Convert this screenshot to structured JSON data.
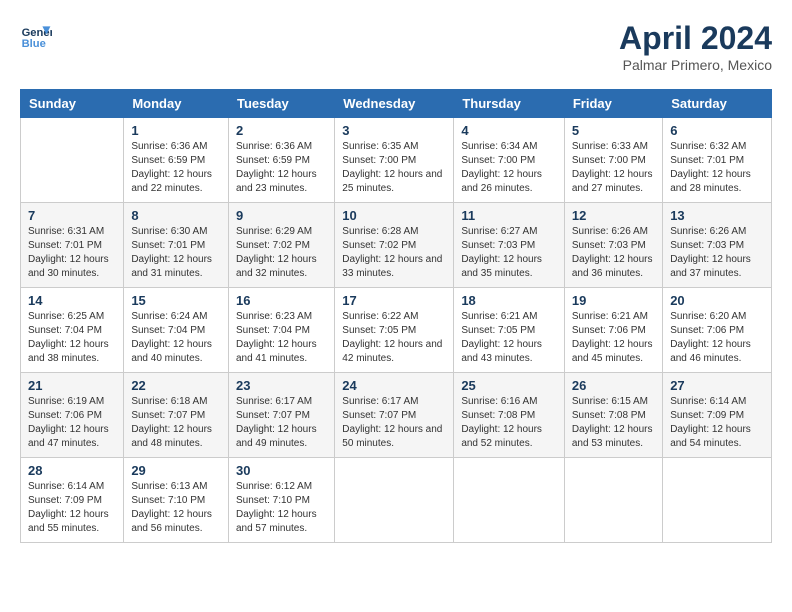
{
  "header": {
    "logo_line1": "General",
    "logo_line2": "Blue",
    "title": "April 2024",
    "location": "Palmar Primero, Mexico"
  },
  "weekdays": [
    "Sunday",
    "Monday",
    "Tuesday",
    "Wednesday",
    "Thursday",
    "Friday",
    "Saturday"
  ],
  "weeks": [
    [
      {
        "day": "",
        "sunrise": "",
        "sunset": "",
        "daylight": ""
      },
      {
        "day": "1",
        "sunrise": "Sunrise: 6:36 AM",
        "sunset": "Sunset: 6:59 PM",
        "daylight": "Daylight: 12 hours and 22 minutes."
      },
      {
        "day": "2",
        "sunrise": "Sunrise: 6:36 AM",
        "sunset": "Sunset: 6:59 PM",
        "daylight": "Daylight: 12 hours and 23 minutes."
      },
      {
        "day": "3",
        "sunrise": "Sunrise: 6:35 AM",
        "sunset": "Sunset: 7:00 PM",
        "daylight": "Daylight: 12 hours and 25 minutes."
      },
      {
        "day": "4",
        "sunrise": "Sunrise: 6:34 AM",
        "sunset": "Sunset: 7:00 PM",
        "daylight": "Daylight: 12 hours and 26 minutes."
      },
      {
        "day": "5",
        "sunrise": "Sunrise: 6:33 AM",
        "sunset": "Sunset: 7:00 PM",
        "daylight": "Daylight: 12 hours and 27 minutes."
      },
      {
        "day": "6",
        "sunrise": "Sunrise: 6:32 AM",
        "sunset": "Sunset: 7:01 PM",
        "daylight": "Daylight: 12 hours and 28 minutes."
      }
    ],
    [
      {
        "day": "7",
        "sunrise": "Sunrise: 6:31 AM",
        "sunset": "Sunset: 7:01 PM",
        "daylight": "Daylight: 12 hours and 30 minutes."
      },
      {
        "day": "8",
        "sunrise": "Sunrise: 6:30 AM",
        "sunset": "Sunset: 7:01 PM",
        "daylight": "Daylight: 12 hours and 31 minutes."
      },
      {
        "day": "9",
        "sunrise": "Sunrise: 6:29 AM",
        "sunset": "Sunset: 7:02 PM",
        "daylight": "Daylight: 12 hours and 32 minutes."
      },
      {
        "day": "10",
        "sunrise": "Sunrise: 6:28 AM",
        "sunset": "Sunset: 7:02 PM",
        "daylight": "Daylight: 12 hours and 33 minutes."
      },
      {
        "day": "11",
        "sunrise": "Sunrise: 6:27 AM",
        "sunset": "Sunset: 7:03 PM",
        "daylight": "Daylight: 12 hours and 35 minutes."
      },
      {
        "day": "12",
        "sunrise": "Sunrise: 6:26 AM",
        "sunset": "Sunset: 7:03 PM",
        "daylight": "Daylight: 12 hours and 36 minutes."
      },
      {
        "day": "13",
        "sunrise": "Sunrise: 6:26 AM",
        "sunset": "Sunset: 7:03 PM",
        "daylight": "Daylight: 12 hours and 37 minutes."
      }
    ],
    [
      {
        "day": "14",
        "sunrise": "Sunrise: 6:25 AM",
        "sunset": "Sunset: 7:04 PM",
        "daylight": "Daylight: 12 hours and 38 minutes."
      },
      {
        "day": "15",
        "sunrise": "Sunrise: 6:24 AM",
        "sunset": "Sunset: 7:04 PM",
        "daylight": "Daylight: 12 hours and 40 minutes."
      },
      {
        "day": "16",
        "sunrise": "Sunrise: 6:23 AM",
        "sunset": "Sunset: 7:04 PM",
        "daylight": "Daylight: 12 hours and 41 minutes."
      },
      {
        "day": "17",
        "sunrise": "Sunrise: 6:22 AM",
        "sunset": "Sunset: 7:05 PM",
        "daylight": "Daylight: 12 hours and 42 minutes."
      },
      {
        "day": "18",
        "sunrise": "Sunrise: 6:21 AM",
        "sunset": "Sunset: 7:05 PM",
        "daylight": "Daylight: 12 hours and 43 minutes."
      },
      {
        "day": "19",
        "sunrise": "Sunrise: 6:21 AM",
        "sunset": "Sunset: 7:06 PM",
        "daylight": "Daylight: 12 hours and 45 minutes."
      },
      {
        "day": "20",
        "sunrise": "Sunrise: 6:20 AM",
        "sunset": "Sunset: 7:06 PM",
        "daylight": "Daylight: 12 hours and 46 minutes."
      }
    ],
    [
      {
        "day": "21",
        "sunrise": "Sunrise: 6:19 AM",
        "sunset": "Sunset: 7:06 PM",
        "daylight": "Daylight: 12 hours and 47 minutes."
      },
      {
        "day": "22",
        "sunrise": "Sunrise: 6:18 AM",
        "sunset": "Sunset: 7:07 PM",
        "daylight": "Daylight: 12 hours and 48 minutes."
      },
      {
        "day": "23",
        "sunrise": "Sunrise: 6:17 AM",
        "sunset": "Sunset: 7:07 PM",
        "daylight": "Daylight: 12 hours and 49 minutes."
      },
      {
        "day": "24",
        "sunrise": "Sunrise: 6:17 AM",
        "sunset": "Sunset: 7:07 PM",
        "daylight": "Daylight: 12 hours and 50 minutes."
      },
      {
        "day": "25",
        "sunrise": "Sunrise: 6:16 AM",
        "sunset": "Sunset: 7:08 PM",
        "daylight": "Daylight: 12 hours and 52 minutes."
      },
      {
        "day": "26",
        "sunrise": "Sunrise: 6:15 AM",
        "sunset": "Sunset: 7:08 PM",
        "daylight": "Daylight: 12 hours and 53 minutes."
      },
      {
        "day": "27",
        "sunrise": "Sunrise: 6:14 AM",
        "sunset": "Sunset: 7:09 PM",
        "daylight": "Daylight: 12 hours and 54 minutes."
      }
    ],
    [
      {
        "day": "28",
        "sunrise": "Sunrise: 6:14 AM",
        "sunset": "Sunset: 7:09 PM",
        "daylight": "Daylight: 12 hours and 55 minutes."
      },
      {
        "day": "29",
        "sunrise": "Sunrise: 6:13 AM",
        "sunset": "Sunset: 7:10 PM",
        "daylight": "Daylight: 12 hours and 56 minutes."
      },
      {
        "day": "30",
        "sunrise": "Sunrise: 6:12 AM",
        "sunset": "Sunset: 7:10 PM",
        "daylight": "Daylight: 12 hours and 57 minutes."
      },
      {
        "day": "",
        "sunrise": "",
        "sunset": "",
        "daylight": ""
      },
      {
        "day": "",
        "sunrise": "",
        "sunset": "",
        "daylight": ""
      },
      {
        "day": "",
        "sunrise": "",
        "sunset": "",
        "daylight": ""
      },
      {
        "day": "",
        "sunrise": "",
        "sunset": "",
        "daylight": ""
      }
    ]
  ]
}
